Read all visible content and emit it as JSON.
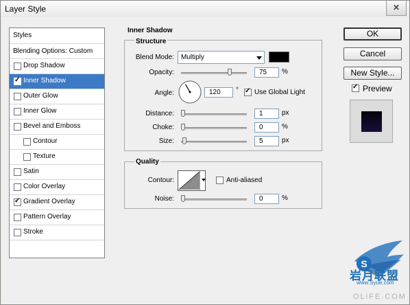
{
  "window": {
    "title": "Layer Style",
    "close_glyph": "✕"
  },
  "styles_list": {
    "header": "Styles",
    "blending_options": "Blending Options: Custom",
    "items": [
      {
        "label": "Drop Shadow",
        "checked": false,
        "selected": false,
        "sub": false
      },
      {
        "label": "Inner Shadow",
        "checked": true,
        "selected": true,
        "sub": false
      },
      {
        "label": "Outer Glow",
        "checked": false,
        "selected": false,
        "sub": false
      },
      {
        "label": "Inner Glow",
        "checked": false,
        "selected": false,
        "sub": false
      },
      {
        "label": "Bevel and Emboss",
        "checked": false,
        "selected": false,
        "sub": false
      },
      {
        "label": "Contour",
        "checked": false,
        "selected": false,
        "sub": true
      },
      {
        "label": "Texture",
        "checked": false,
        "selected": false,
        "sub": true
      },
      {
        "label": "Satin",
        "checked": false,
        "selected": false,
        "sub": false
      },
      {
        "label": "Color Overlay",
        "checked": false,
        "selected": false,
        "sub": false
      },
      {
        "label": "Gradient Overlay",
        "checked": true,
        "selected": false,
        "sub": false
      },
      {
        "label": "Pattern Overlay",
        "checked": false,
        "selected": false,
        "sub": false
      },
      {
        "label": "Stroke",
        "checked": false,
        "selected": false,
        "sub": false
      }
    ]
  },
  "inner_shadow": {
    "section_title": "Inner Shadow",
    "structure": {
      "title": "Structure",
      "blend_mode_label": "Blend Mode:",
      "blend_mode_value": "Multiply",
      "shadow_color": "#000000",
      "opacity_label": "Opacity:",
      "opacity_value": "75",
      "opacity_unit": "%",
      "opacity_slider": 0.75,
      "angle_label": "Angle:",
      "angle_value": "120",
      "angle_unit": "°",
      "use_global_light_label": "Use Global Light",
      "use_global_light_checked": true,
      "distance_label": "Distance:",
      "distance_value": "1",
      "distance_unit": "px",
      "distance_slider": 0.0,
      "choke_label": "Choke:",
      "choke_value": "0",
      "choke_unit": "%",
      "choke_slider": 0.0,
      "size_label": "Size:",
      "size_value": "5",
      "size_unit": "px",
      "size_slider": 0.02
    },
    "quality": {
      "title": "Quality",
      "contour_label": "Contour:",
      "anti_aliased_label": "Anti-aliased",
      "anti_aliased_checked": false,
      "noise_label": "Noise:",
      "noise_value": "0",
      "noise_unit": "%",
      "noise_slider": 0.0
    }
  },
  "buttons": {
    "ok": "OK",
    "cancel": "Cancel",
    "new_style": "New Style...",
    "preview_label": "Preview",
    "preview_checked": true
  },
  "watermark": {
    "text": "岩月联盟",
    "url": "www.Syue.com",
    "corner": "OLiFE.COM"
  }
}
